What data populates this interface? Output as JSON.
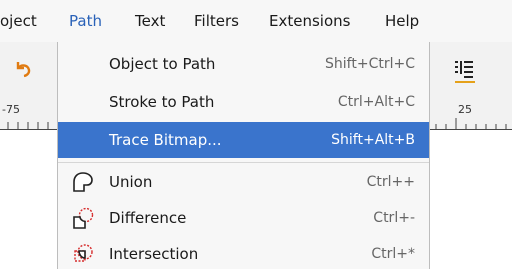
{
  "menubar": {
    "items": [
      {
        "label": "oject"
      },
      {
        "label": "Path"
      },
      {
        "label": "Text"
      },
      {
        "label": "Filters"
      },
      {
        "label": "Extensions"
      },
      {
        "label": "Help"
      }
    ]
  },
  "ruler": {
    "left_number": "-75",
    "right_number": "25"
  },
  "path_menu": {
    "items": [
      {
        "label": "Object to Path",
        "shortcut": "Shift+Ctrl+C",
        "icon": null
      },
      {
        "label": "Stroke to Path",
        "shortcut": "Ctrl+Alt+C",
        "icon": null
      },
      {
        "label": "Trace Bitmap...",
        "shortcut": "Shift+Alt+B",
        "icon": null,
        "highlighted": true
      },
      {
        "label": "Union",
        "shortcut": "Ctrl++",
        "icon": "union-icon"
      },
      {
        "label": "Difference",
        "shortcut": "Ctrl+-",
        "icon": "difference-icon"
      },
      {
        "label": "Intersection",
        "shortcut": "Ctrl+*",
        "icon": "intersection-icon"
      }
    ]
  },
  "colors": {
    "highlight": "#3a74cc",
    "active_menu": "#2a62b8",
    "accent_icon": "#e5a11a"
  }
}
